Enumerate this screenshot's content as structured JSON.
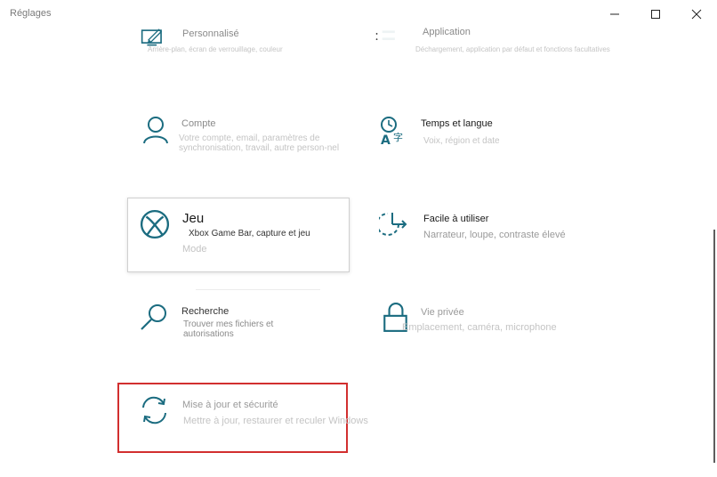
{
  "window": {
    "title": "Réglages",
    "controls": {
      "minimize": "minimize-icon",
      "maximize": "maximize-icon",
      "close": "close-icon"
    }
  },
  "colors": {
    "accent": "#1b6c80",
    "highlight": "#d22f2f",
    "focus_border": "#d0d0d0"
  },
  "tiles": {
    "personalise": {
      "title": "Personnalisé",
      "desc": "Arrière-plan, écran de verrouillage, couleur",
      "icon": "personalization-icon"
    },
    "application": {
      "title": "Application",
      "desc": "Déchargement, application par défaut et fonctions facultatives",
      "icon": "apps-icon"
    },
    "compte": {
      "title": "Compte",
      "desc": "Votre compte, email, paramètres de synchronisation, travail, autre person-nel",
      "icon": "account-icon"
    },
    "temps": {
      "title": "Temps et langue",
      "desc": "Voix, région et date",
      "icon": "time-language-icon"
    },
    "jeu": {
      "title": "Jeu",
      "desc": "Xbox Game Bar, capture et jeu",
      "extra": "Mode",
      "icon": "xbox-icon"
    },
    "facile": {
      "title": "Facile à utiliser",
      "desc": "Narrateur, loupe, contraste élevé",
      "icon": "ease-of-access-icon"
    },
    "recherche": {
      "title": "Recherche",
      "desc": "Trouver mes fichiers et autorisations",
      "icon": "search-icon"
    },
    "vie_privee": {
      "title": "Vie privée",
      "desc": "Emplacement, caméra, microphone",
      "icon": "lock-icon"
    },
    "maj": {
      "title": "Mise à jour et sécurité",
      "desc": "Mettre à jour, restaurer et reculer Windows",
      "icon": "update-icon"
    }
  }
}
